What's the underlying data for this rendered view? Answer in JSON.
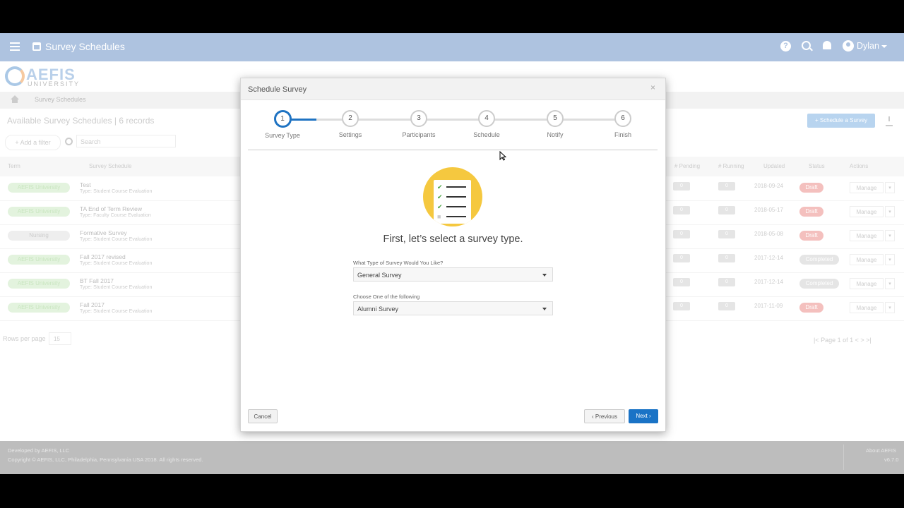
{
  "topbar": {
    "title": "Survey Schedules",
    "user": "Dylan",
    "help": "?"
  },
  "logo": {
    "name": "AEFIS",
    "sub": "UNIVERSITY"
  },
  "breadcrumb": {
    "current": "Survey Schedules"
  },
  "list": {
    "heading": "Available Survey Schedules",
    "count": "| 6 records",
    "schedule_button": "+ Schedule a Survey",
    "add_filter": "+ Add a filter",
    "search_placeholder": "Search",
    "columns": [
      "Term",
      "Survey Schedule",
      "# Pending",
      "# Running",
      "Updated",
      "Status",
      "Actions"
    ],
    "rows": [
      {
        "term": "AEFIS University",
        "name": "Test",
        "type": "Type: Student Course Evaluation",
        "updated": "2018-09-24",
        "status": "Draft"
      },
      {
        "term": "AEFIS University",
        "name": "TA End of Term Review",
        "type": "Type: Faculty Course Evaluation",
        "updated": "2018-05-17",
        "status": "Draft"
      },
      {
        "term": "Nursing",
        "name": "Formative Survey",
        "type": "Type: Student Course Evaluation",
        "updated": "2018-05-08",
        "status": "Draft"
      },
      {
        "term": "AEFIS University",
        "name": "Fall 2017 revised",
        "type": "Type: Student Course Evaluation",
        "updated": "2017-12-14",
        "status": "Completed"
      },
      {
        "term": "AEFIS University",
        "name": "BT Fall 2017",
        "type": "Type: Student Course Evaluation",
        "updated": "2017-12-14",
        "status": "Completed"
      },
      {
        "term": "AEFIS University",
        "name": "Fall 2017",
        "type": "Type: Student Course Evaluation",
        "updated": "2017-11-09",
        "status": "Draft"
      }
    ],
    "pill_value": "0",
    "manage_label": "Manage",
    "rows_per_page_label": "Rows per page",
    "rows_per_page": "15",
    "pager": "|< Page 1 of 1 < > >|"
  },
  "footer": {
    "developed": "Developed by AEFIS, LLC",
    "copyright": "Copyright © AEFIS, LLC, Philadelphia, Pennsylvania USA 2018. All rights reserved.",
    "about": "About AEFIS",
    "version": "v6.7.0"
  },
  "modal": {
    "title": "Schedule Survey",
    "close": "×",
    "steps": [
      {
        "num": "1",
        "label": "Survey Type"
      },
      {
        "num": "2",
        "label": "Settings"
      },
      {
        "num": "3",
        "label": "Participants"
      },
      {
        "num": "4",
        "label": "Schedule"
      },
      {
        "num": "5",
        "label": "Notify"
      },
      {
        "num": "6",
        "label": "Finish"
      }
    ],
    "heading": "First, let’s select a survey type.",
    "field1_label": "What Type of Survey Would You Like?",
    "field1_value": "General Survey",
    "field2_label": "Choose One of the following",
    "field2_value": "Alumni Survey",
    "cancel": "Cancel",
    "previous": "‹ Previous",
    "next": "Next ›"
  },
  "colors": {
    "primary": "#1a73c6",
    "topbar": "#aec3e0",
    "illustration": "#f5c83f"
  }
}
